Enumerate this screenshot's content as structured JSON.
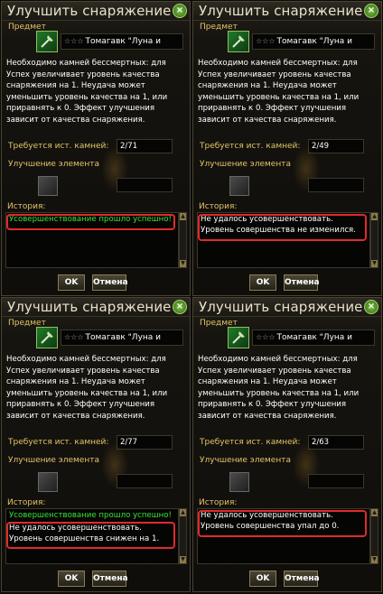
{
  "panels": [
    {
      "title": "Улучшить снаряжение",
      "item_section": "Предмет",
      "item_stars": "☆☆☆",
      "item_name": "Томагавк \"Луна и",
      "description": "Необходимо камней бессмертных: для Успех увеличивает уровень качества снаряжения на 1. Неудача может уменьшить уровень качества на 1, или приравнять к 0. Эффект улучшения зависит от качества снаряжения.",
      "stones_label": "Требуется ист. камней:",
      "stones_value": "2/71",
      "element_label": "Улучшение элемента",
      "history_label": "История:",
      "history": [
        {
          "text": "Усовершенствование прошло успешно!",
          "color": "green"
        }
      ],
      "ok_label": "OK",
      "cancel_label": "Отмена"
    },
    {
      "title": "Улучшить снаряжение",
      "item_section": "Предмет",
      "item_stars": "☆☆☆",
      "item_name": "Томагавк \"Луна и",
      "description": "Необходимо камней бессмертных: для Успех увеличивает уровень качества снаряжения на 1. Неудача может уменьшить уровень качества на 1, или приравнять к 0. Эффект улучшения зависит от качества снаряжения.",
      "stones_label": "Требуется ист. камней:",
      "stones_value": "2/49",
      "element_label": "Улучшение элемента",
      "history_label": "История:",
      "history": [
        {
          "text": "Не удалось усовершенствовать. Уровень совершенства не изменился.",
          "color": "white"
        }
      ],
      "ok_label": "OK",
      "cancel_label": "Отмена"
    },
    {
      "title": "Улучшить снаряжение",
      "item_section": "Предмет",
      "item_stars": "☆☆☆",
      "item_name": "Томагавк \"Луна и",
      "description": "Необходимо камней бессмертных: для Успех увеличивает уровень качества снаряжения на 1. Неудача может уменьшить уровень качества на 1, или приравнять к 0. Эффект улучшения зависит от качества снаряжения.",
      "stones_label": "Требуется ист. камней:",
      "stones_value": "2/77",
      "element_label": "Улучшение элемента",
      "history_label": "История:",
      "history": [
        {
          "text": "Усовершенствование прошло успешно!",
          "color": "green"
        },
        {
          "text": "Не удалось усовершенствовать. Уровень совершенства снижен на 1.",
          "color": "white"
        }
      ],
      "ok_label": "OK",
      "cancel_label": "Отмена"
    },
    {
      "title": "Улучшить снаряжение",
      "item_section": "Предмет",
      "item_stars": "☆☆☆",
      "item_name": "Томагавк \"Луна и",
      "description": "Необходимо камней бессмертных: для Успех увеличивает уровень качества снаряжения на 1. Неудача может уменьшить уровень качества на 1, или приравнять к 0. Эффект улучшения зависит от качества снаряжения.",
      "stones_label": "Требуется ист. камней:",
      "stones_value": "2/63",
      "element_label": "Улучшение элемента",
      "history_label": "История:",
      "history": [
        {
          "text": "Не удалось усовершенствовать. Уровень совершенства упал до 0.",
          "color": "white"
        }
      ],
      "ok_label": "OK",
      "cancel_label": "Отмена"
    }
  ],
  "colors": {
    "label_gold": "#e3c46a",
    "success_green": "#39e23a",
    "highlight_red": "#e02b2b"
  },
  "icons": {
    "close": "close-icon",
    "item": "tomahawk-icon"
  }
}
